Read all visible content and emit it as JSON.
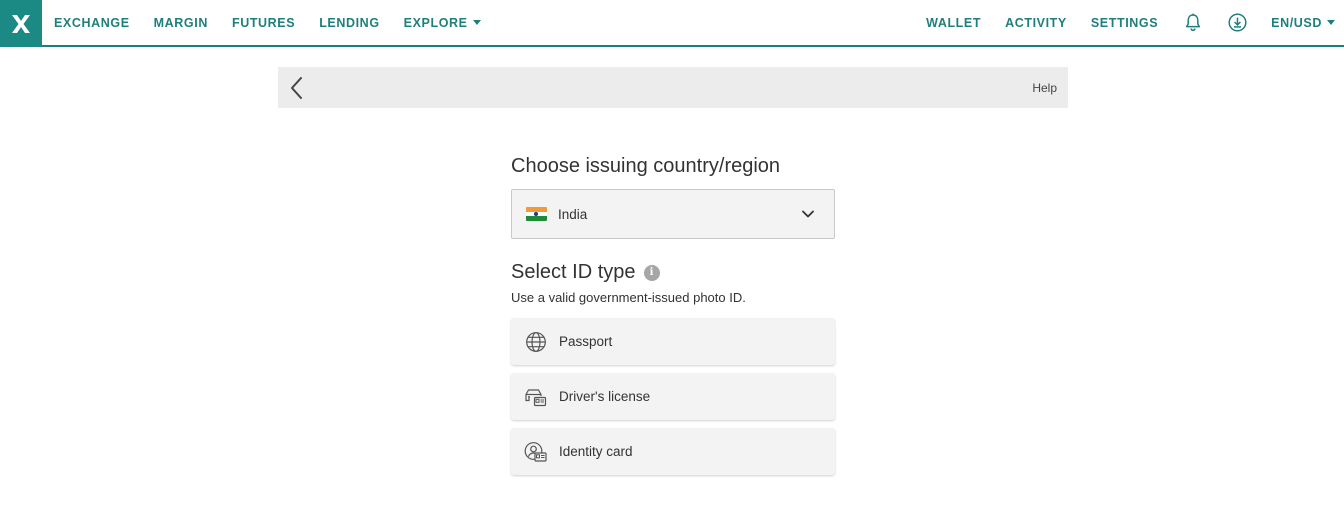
{
  "nav": {
    "left": [
      {
        "label": "EXCHANGE"
      },
      {
        "label": "MARGIN"
      },
      {
        "label": "FUTURES"
      },
      {
        "label": "LENDING"
      },
      {
        "label": "EXPLORE"
      }
    ],
    "right": {
      "wallet": "WALLET",
      "activity": "ACTIVITY",
      "settings": "SETTINGS",
      "locale": "EN/USD"
    },
    "icons": [
      "bell-icon",
      "download-icon"
    ]
  },
  "subheader": {
    "help_label": "Help"
  },
  "country": {
    "heading": "Choose issuing country/region",
    "selected": "India"
  },
  "id_type": {
    "heading": "Select ID type",
    "info_glyph": "i",
    "description": "Use a valid government-issued photo ID.",
    "options": [
      {
        "label": "Passport",
        "icon": "globe-icon"
      },
      {
        "label": "Driver's license",
        "icon": "car-id-icon"
      },
      {
        "label": "Identity card",
        "icon": "person-id-icon"
      }
    ]
  },
  "colors": {
    "brand": "#1b8a85",
    "nav_text": "#1f7f7a",
    "flag_saffron": "#f29a38",
    "flag_green": "#1f8a3a"
  }
}
